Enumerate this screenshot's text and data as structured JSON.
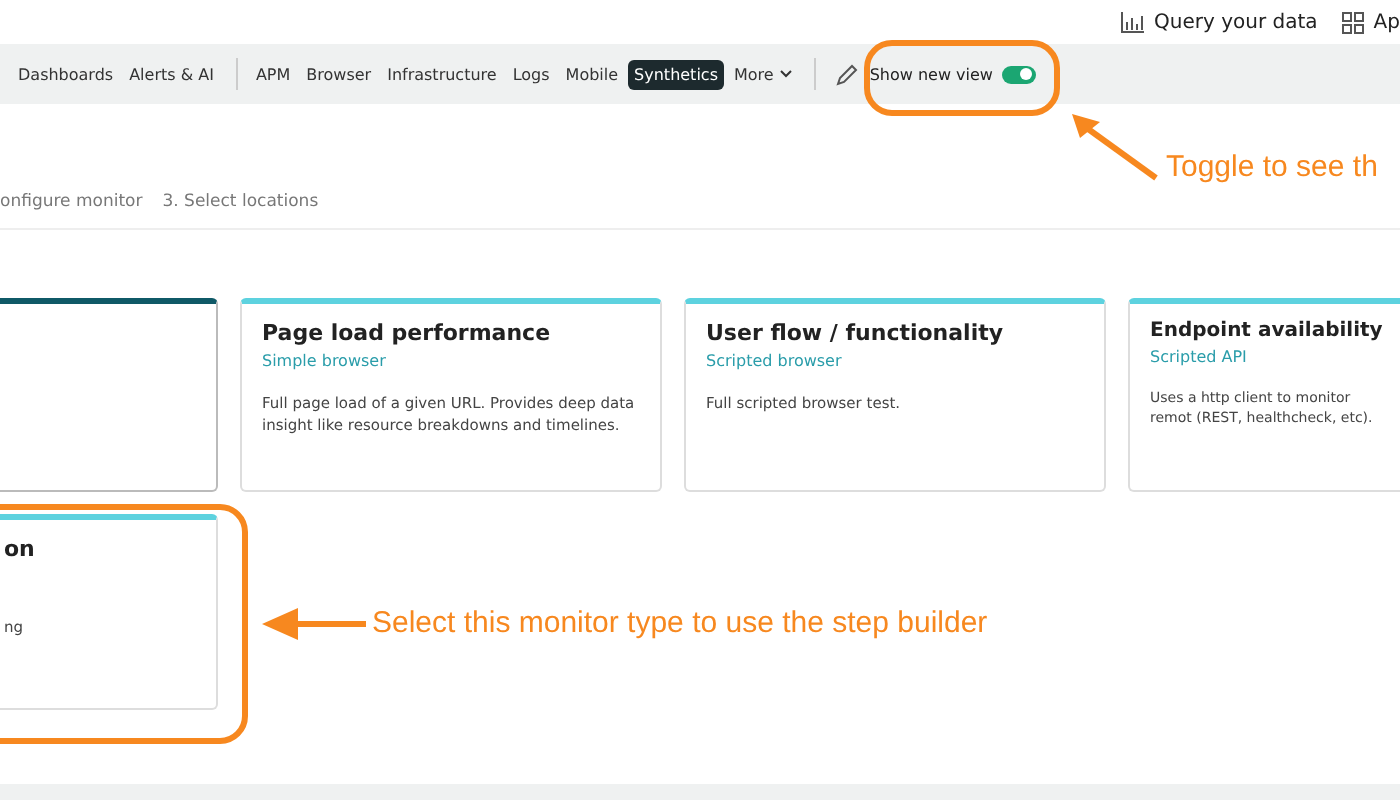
{
  "top_bar": {
    "query_label": "Query your data",
    "apps_label": "Ap"
  },
  "nav": {
    "items": [
      {
        "label": "Dashboards",
        "selected": false
      },
      {
        "label": "Alerts & AI",
        "selected": false
      },
      {
        "label": "APM",
        "selected": false
      },
      {
        "label": "Browser",
        "selected": false
      },
      {
        "label": "Infrastructure",
        "selected": false
      },
      {
        "label": "Logs",
        "selected": false
      },
      {
        "label": "Mobile",
        "selected": false
      },
      {
        "label": "Synthetics",
        "selected": true
      },
      {
        "label": "More",
        "selected": false
      }
    ],
    "new_view": {
      "label": "Show new view",
      "on": true
    }
  },
  "steps": [
    "onfigure monitor",
    "3. Select locations"
  ],
  "cards": [
    {
      "selected": true
    },
    {
      "title": "Page load performance",
      "subtitle": "Simple browser",
      "description": "Full page load of a given URL. Provides deep data insight like resource breakdowns and timelines.",
      "selected": false
    },
    {
      "title": "User flow / functionality",
      "subtitle": "Scripted browser",
      "description": "Full scripted browser test.",
      "selected": false
    },
    {
      "title": "Endpoint availability",
      "subtitle": "Scripted API",
      "description": "Uses a http client to monitor remot (REST, healthcheck, etc).",
      "selected": false
    },
    {
      "title": "on",
      "description": "ng",
      "selected": false
    }
  ],
  "annotations": [
    {
      "text": "Toggle to see th"
    },
    {
      "text": "Select this monitor type to use the step builder"
    }
  ]
}
